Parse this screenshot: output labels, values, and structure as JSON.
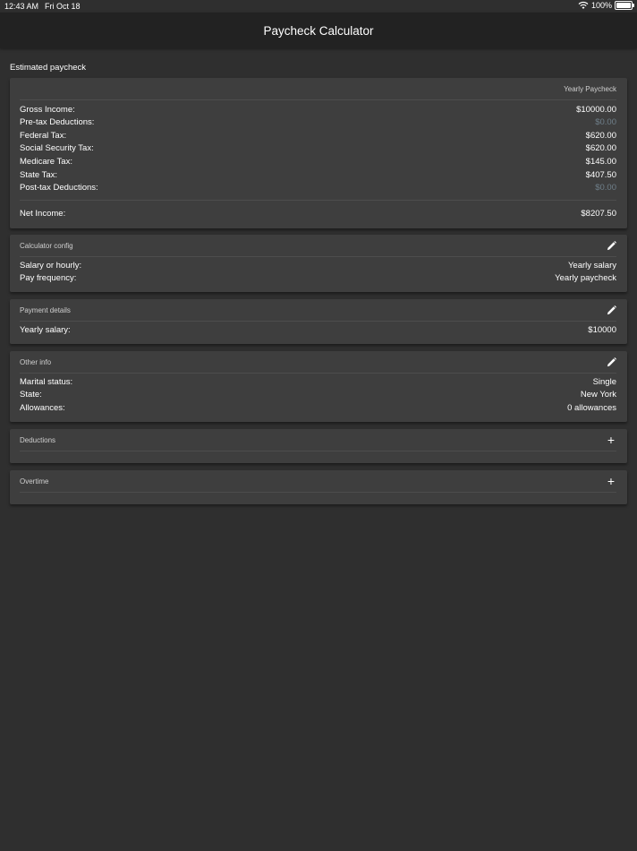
{
  "status_bar": {
    "time": "12:43 AM",
    "date": "Fri Oct 18",
    "battery": "100%"
  },
  "navbar": {
    "title": "Paycheck Calculator"
  },
  "estimate": {
    "section_title": "Estimated paycheck",
    "header": "Yearly Paycheck",
    "rows": [
      {
        "label": "Gross Income:",
        "value": "$10000.00"
      },
      {
        "label": "Pre-tax Deductions:",
        "value": "$0.00"
      },
      {
        "label": "Federal Tax:",
        "value": "$620.00"
      },
      {
        "label": "Social Security Tax:",
        "value": "$620.00"
      },
      {
        "label": "Medicare Tax:",
        "value": "$145.00"
      },
      {
        "label": "State Tax:",
        "value": "$407.50"
      },
      {
        "label": "Post-tax Deductions:",
        "value": "$0.00"
      }
    ],
    "net": {
      "label": "Net Income:",
      "value": "$8207.50"
    }
  },
  "calculator_config": {
    "header": "Calculator config",
    "rows": [
      {
        "label": "Salary or hourly:",
        "value": "Yearly salary"
      },
      {
        "label": "Pay frequency:",
        "value": "Yearly paycheck"
      }
    ]
  },
  "payment_details": {
    "header": "Payment details",
    "rows": [
      {
        "label": "Yearly salary:",
        "value": "$10000"
      }
    ]
  },
  "other_info": {
    "header": "Other info",
    "rows": [
      {
        "label": "Marital status:",
        "value": "Single"
      },
      {
        "label": "State:",
        "value": "New York"
      },
      {
        "label": "Allowances:",
        "value": "0 allowances"
      }
    ]
  },
  "deductions": {
    "header": "Deductions",
    "add_symbol": "+"
  },
  "overtime": {
    "header": "Overtime",
    "add_symbol": "+"
  },
  "icons": {
    "edit": "pencil-icon",
    "add": "plus-icon"
  },
  "colors": {
    "background": "#2f2f2f",
    "card": "#3e3e3e",
    "navbar": "#222222",
    "muted_value": "#6f7f8a"
  }
}
